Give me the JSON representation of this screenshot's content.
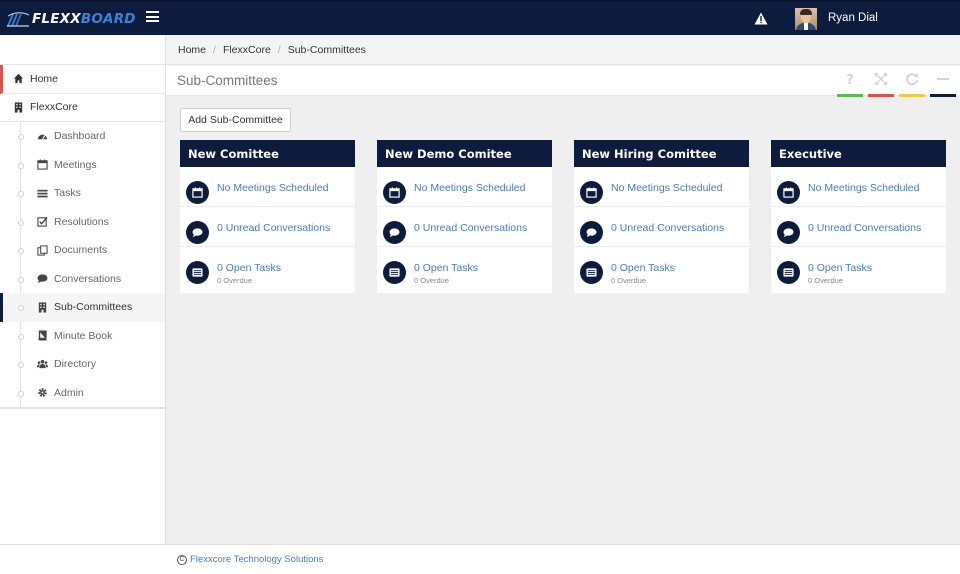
{
  "app": {
    "logo_main": "FLEXX",
    "logo_accent": "BOARD",
    "user_name": "Ryan Dial"
  },
  "sidebar": {
    "home": "Home",
    "flexxcore": "FlexxCore",
    "items": [
      {
        "label": "Dashboard",
        "icon": "dashboard-icon"
      },
      {
        "label": "Meetings",
        "icon": "calendar-icon"
      },
      {
        "label": "Tasks",
        "icon": "tasks-icon"
      },
      {
        "label": "Resolutions",
        "icon": "checkbox-icon"
      },
      {
        "label": "Documents",
        "icon": "documents-icon"
      },
      {
        "label": "Conversations",
        "icon": "chat-icon"
      },
      {
        "label": "Sub-Committees",
        "icon": "building-icon"
      },
      {
        "label": "Minute Book",
        "icon": "book-icon"
      },
      {
        "label": "Directory",
        "icon": "users-icon"
      },
      {
        "label": "Admin",
        "icon": "gear-icon"
      }
    ],
    "active": "Sub-Committees"
  },
  "breadcrumb": [
    "Home",
    "FlexxCore",
    "Sub-Committees"
  ],
  "page": {
    "title": "Sub-Committees",
    "add_button": "Add Sub-Committee"
  },
  "colors": {
    "navy": "#0d1b3d",
    "green": "#5cb85c",
    "red": "#d9534f",
    "yellow": "#f0c84a",
    "link": "#4a7cb2"
  },
  "committees": [
    {
      "name": "New Comittee",
      "meetings": "No Meetings Scheduled",
      "conversations": "0 Unread Conversations",
      "tasks": "0 Open Tasks",
      "overdue": "0 Overdue"
    },
    {
      "name": "New Demo Comitee",
      "meetings": "No Meetings Scheduled",
      "conversations": "0 Unread Conversations",
      "tasks": "0 Open Tasks",
      "overdue": "0 Overdue"
    },
    {
      "name": "New Hiring Comittee",
      "meetings": "No Meetings Scheduled",
      "conversations": "0 Unread Conversations",
      "tasks": "0 Open Tasks",
      "overdue": "0 Overdue"
    },
    {
      "name": "Executive",
      "meetings": "No Meetings Scheduled",
      "conversations": "0 Unread Conversations",
      "tasks": "0 Open Tasks",
      "overdue": "0 Overdue"
    }
  ],
  "footer": {
    "copyright_symbol": "C",
    "company": "Flexxcore Technology Solutions"
  }
}
